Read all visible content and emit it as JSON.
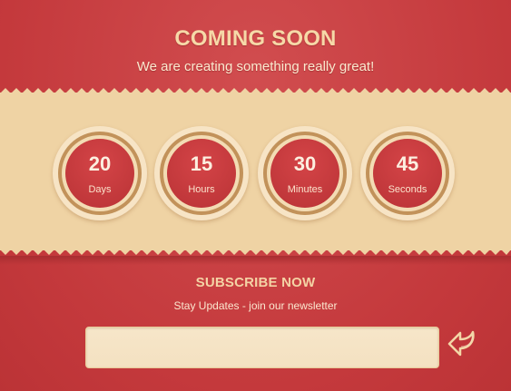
{
  "hero": {
    "title": "COMING SOON",
    "subtitle": "We are creating something really great!"
  },
  "countdown": [
    {
      "value": "20",
      "unit": "Days"
    },
    {
      "value": "15",
      "unit": "Hours"
    },
    {
      "value": "30",
      "unit": "Minutes"
    },
    {
      "value": "45",
      "unit": "Seconds"
    }
  ],
  "subscribe": {
    "title": "SUBSCRIBE NOW",
    "text": "Stay Updates - join our newsletter",
    "email_value": "",
    "email_placeholder": "",
    "submit_icon": "return-arrow-icon"
  },
  "colors": {
    "background": "#c94547",
    "band": "#efd3a4",
    "title": "#f6d9a8",
    "disc": "#c0373a"
  }
}
